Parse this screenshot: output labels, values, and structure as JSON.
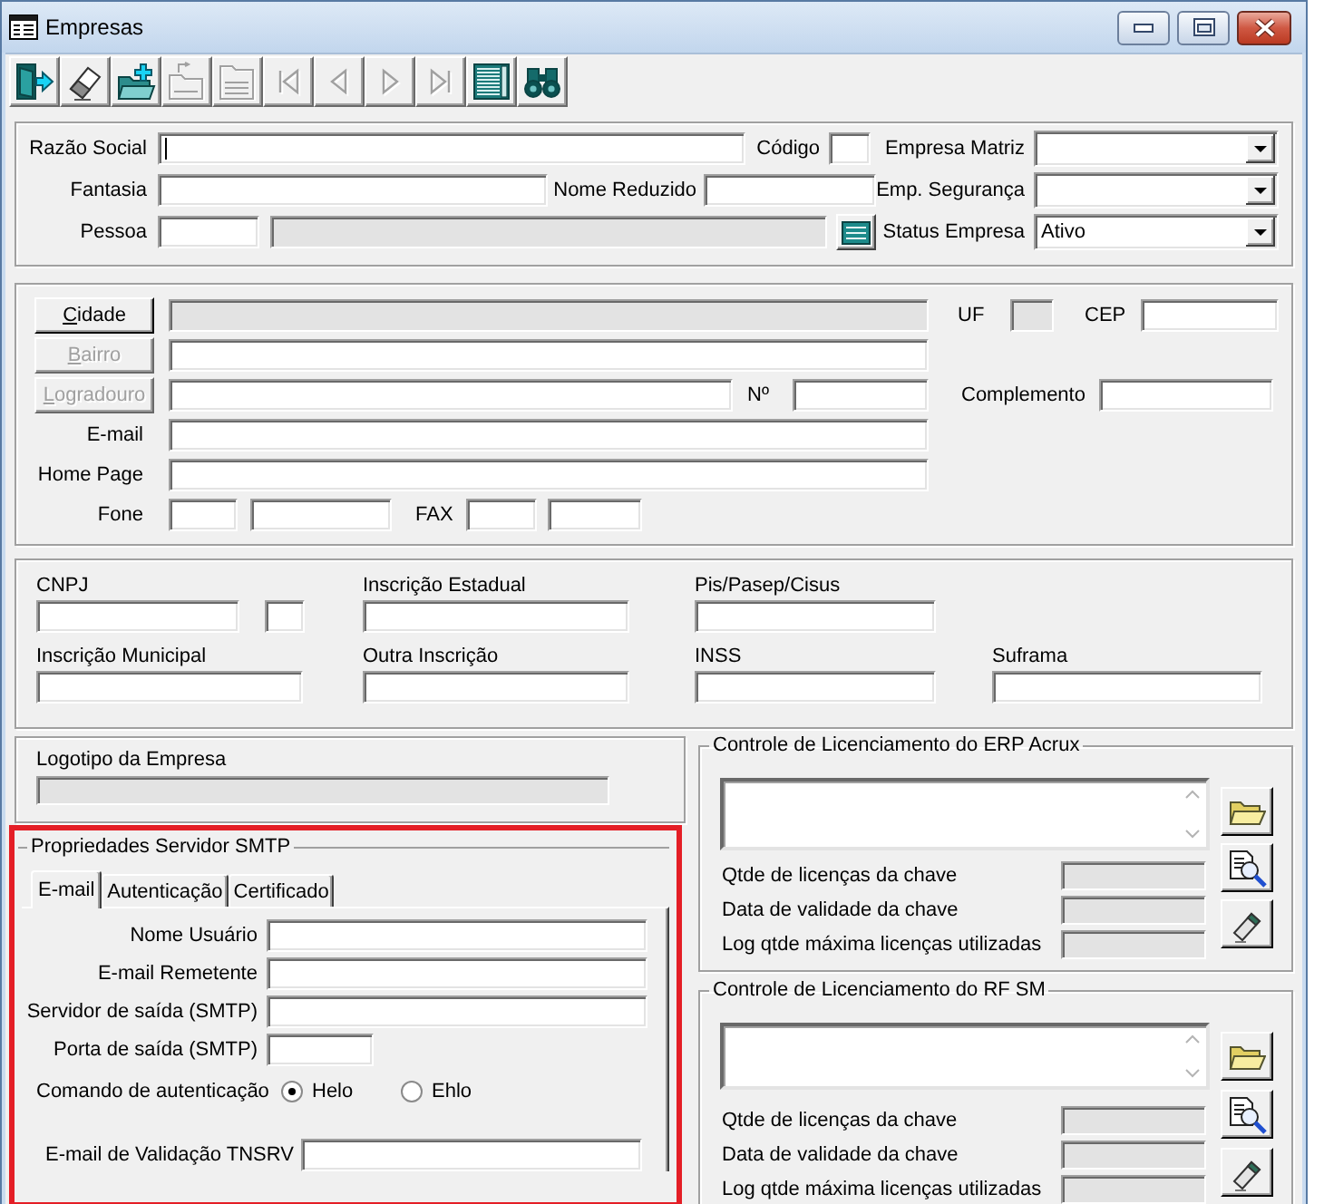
{
  "window": {
    "title": "Empresas"
  },
  "toolbar": [
    {
      "kind": "exit",
      "disabled": false
    },
    {
      "kind": "erase",
      "disabled": false
    },
    {
      "kind": "add",
      "disabled": false
    },
    {
      "kind": "moveup",
      "disabled": true
    },
    {
      "kind": "movedown",
      "disabled": true
    },
    {
      "kind": "first",
      "disabled": true
    },
    {
      "kind": "prior",
      "disabled": true
    },
    {
      "kind": "next",
      "disabled": true
    },
    {
      "kind": "last",
      "disabled": true
    },
    {
      "kind": "grid",
      "disabled": false
    },
    {
      "kind": "find",
      "disabled": false
    }
  ],
  "identity": {
    "razao_social": {
      "label": "Razão Social",
      "focused": true
    },
    "codigo": {
      "label": "Código"
    },
    "empresa_matriz": {
      "label": "Empresa Matriz"
    },
    "fantasia": {
      "label": "Fantasia"
    },
    "nome_reduzido": {
      "label": "Nome Reduzido"
    },
    "emp_seguranca": {
      "label": "Emp. Segurança"
    },
    "pessoa": {
      "label": "Pessoa",
      "description_readonly": true
    },
    "status_empresa": {
      "label": "Status Empresa",
      "value": "Ativo"
    }
  },
  "address": {
    "cidade": {
      "label": "Cidade",
      "disabled": false,
      "readonly": true
    },
    "uf": {
      "label": "UF",
      "readonly": true
    },
    "cep": {
      "label": "CEP"
    },
    "bairro": {
      "label": "Bairro",
      "disabled": true
    },
    "logradouro": {
      "label": "Logradouro",
      "disabled": true
    },
    "numero": {
      "label": "Nº"
    },
    "complemento": {
      "label": "Complemento"
    },
    "email": {
      "label": "E-mail"
    },
    "home_page": {
      "label": "Home Page"
    },
    "fone": {
      "label": "Fone"
    },
    "fax": {
      "label": "FAX"
    }
  },
  "documents": {
    "cnpj": {
      "label": "CNPJ"
    },
    "inscricao_estadual": {
      "label": "Inscrição Estadual"
    },
    "pis_pasep_cisus": {
      "label": "Pis/Pasep/Cisus"
    },
    "inscricao_municipal": {
      "label": "Inscrição Municipal"
    },
    "outra_inscricao": {
      "label": "Outra Inscrição"
    },
    "inss": {
      "label": "INSS"
    },
    "suframa": {
      "label": "Suframa"
    }
  },
  "logo": {
    "label": "Logotipo da Empresa",
    "readonly": true
  },
  "smtp": {
    "highlighted": true,
    "title": "Propriedades Servidor SMTP",
    "tabs": [
      {
        "label": "E-mail",
        "selected": true
      },
      {
        "label": "Autenticação",
        "selected": false
      },
      {
        "label": "Certificado",
        "selected": false
      }
    ],
    "nome_usuario": {
      "label": "Nome Usuário"
    },
    "email_remetente": {
      "label": "E-mail Remetente"
    },
    "servidor_saida": {
      "label": "Servidor de saída (SMTP)"
    },
    "porta_saida": {
      "label": "Porta de saída (SMTP)"
    },
    "auth_command": {
      "label": "Comando de autenticação",
      "options": [
        {
          "label": "Helo",
          "selected": true
        },
        {
          "label": "Ehlo",
          "selected": false
        }
      ]
    },
    "validation_email": {
      "label": "E-mail de Validação TNSRV"
    }
  },
  "licensing": [
    {
      "title": "Controle de Licenciamento do ERP Acrux",
      "rows": [
        {
          "label": "Qtde de licenças da chave",
          "readonly": true
        },
        {
          "label": "Data de validade da chave",
          "readonly": true
        },
        {
          "label": "Log qtde máxima licenças utilizadas",
          "readonly": true
        }
      ]
    },
    {
      "title": "Controle de Licenciamento do RF SM",
      "rows": [
        {
          "label": "Qtde de licenças da chave",
          "readonly": true
        },
        {
          "label": "Data de validade da chave",
          "readonly": true
        },
        {
          "label": "Log qtde máxima licenças utilizadas",
          "readonly": true
        }
      ]
    }
  ]
}
